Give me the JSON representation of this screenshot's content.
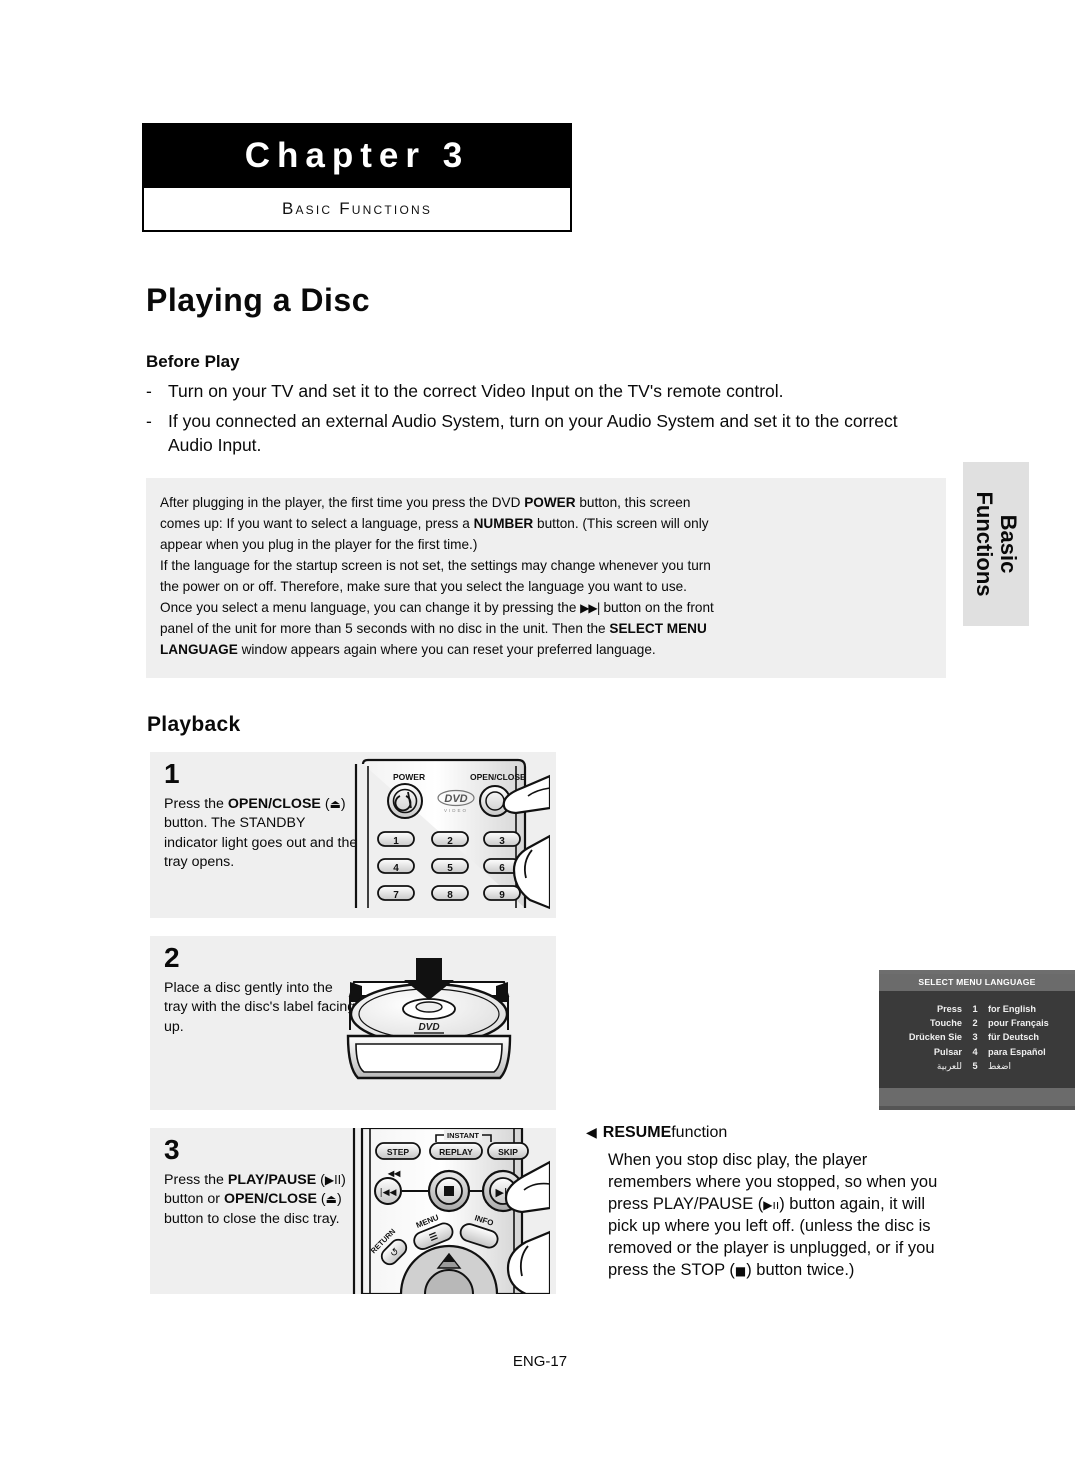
{
  "chapter": {
    "title": "Chapter 3",
    "subtitle": "Basic Functions"
  },
  "page_title": "Playing a Disc",
  "before_play": {
    "heading": "Before Play",
    "dash": "-",
    "items": [
      "Turn on your TV and set it to the correct Video Input on the TV's remote control.",
      "If you connected an external Audio System, turn on your Audio System and set it to the correct Audio Input."
    ]
  },
  "note_panel": {
    "p1_a": "After plugging in the player, the first time you press the DVD ",
    "p1_b": "POWER",
    "p1_c": " button, this screen comes up: If you want to select a language, press a ",
    "p1_d": "NUMBER",
    "p1_e": " button. (This screen will only appear when you plug in the player for the first time.)",
    "p2": "If the language for the startup screen is not set, the settings may change whenever you turn the power on or off. Therefore, make sure that you select the language you want to use.",
    "p3_a": "Once you select a menu language, you can change it by pressing the ",
    "p3_icon": "▶▶|",
    "p3_b": " button on the front panel of the unit for more than 5 seconds with no disc in the unit. Then the ",
    "p3_c": "SELECT MENU LANGUAGE",
    "p3_d": " window appears again where you can reset your preferred language."
  },
  "osd": {
    "title": "SELECT MENU LANGUAGE",
    "rows": [
      {
        "verb": "Press",
        "num": "1",
        "lang": "for English"
      },
      {
        "verb": "Touche",
        "num": "2",
        "lang": "pour Français"
      },
      {
        "verb": "Drücken Sie",
        "num": "3",
        "lang": "für Deutsch"
      },
      {
        "verb": "Pulsar",
        "num": "4",
        "lang": "para Español"
      },
      {
        "verb": "للعربية",
        "num": "5",
        "lang": "اضغط"
      }
    ]
  },
  "side_tab": {
    "line1": "Basic",
    "line2": "Functions"
  },
  "playback": {
    "heading": "Playback",
    "steps": [
      {
        "number": "1",
        "text_a": "Press the ",
        "text_b": "OPEN/CLOSE",
        "text_c": " (",
        "icon": "⏏",
        "text_d": ") button.",
        "text_e": "The STANDBY indicator light goes out and the tray opens."
      },
      {
        "number": "2",
        "text_full": "Place a disc gently into the tray with the disc's label facing up."
      },
      {
        "number": "3",
        "text_a": "Press the ",
        "text_b": "PLAY/PAUSE",
        "icon1": "▶II",
        "text_c": " button or ",
        "text_d": "OPEN/CLOSE",
        "icon2": "⏏",
        "text_e": " button to close the disc tray."
      }
    ]
  },
  "remote_step1": {
    "power_label": "POWER",
    "open_close_label": "OPEN/CLOSE",
    "logo": "DVD",
    "logo_sub": "VIDEO",
    "keys": [
      "1",
      "2",
      "3",
      "4",
      "5",
      "6",
      "7",
      "8",
      "9"
    ]
  },
  "remote_step3": {
    "instant_label": "INSTANT",
    "step_label": "STEP",
    "replay_label": "REPLAY",
    "skip_label": "SKIP",
    "menu_label": "MENU",
    "info_label": "INFO",
    "return_label": "RETURN"
  },
  "resume": {
    "arrow": "◀",
    "head_bold": "RESUME",
    "head_rest": " function",
    "body_a": "When you stop disc play, the player remembers where you stopped, so when you press PLAY/PAUSE (",
    "body_icon1": "▶ıı",
    "body_b": ") button again, it will pick up where you left off. (unless the disc is removed or the player is unplugged, or if you press the STOP (",
    "body_icon2": "■",
    "body_c": ") button twice.)"
  },
  "footer": "ENG-17",
  "colors": {
    "panel_gray": "#efefef",
    "tab_gray": "#e0e0e0",
    "osd_bg": "#3a3a3a",
    "osd_bar": "#6b6b6b",
    "black": "#000000"
  }
}
